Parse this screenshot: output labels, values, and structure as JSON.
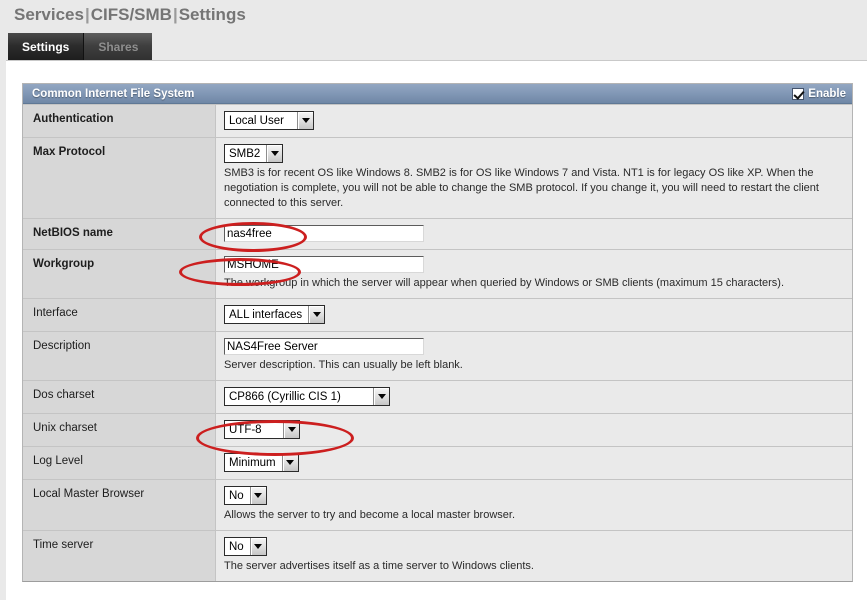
{
  "breadcrumb": {
    "parts": [
      "Services",
      "CIFS/SMB",
      "Settings"
    ],
    "separator": "|",
    "full": "Services | CIFS/SMB | Settings"
  },
  "tabs": [
    {
      "label": "Settings",
      "active": true
    },
    {
      "label": "Shares",
      "active": false
    }
  ],
  "panel": {
    "title": "Common Internet File System",
    "enable_label": "Enable",
    "enable_checked": true,
    "accent_color": "#7f95b4",
    "annotation_color": "#cc1f1f"
  },
  "rows": [
    {
      "label": "Authentication",
      "required": true,
      "control": "select",
      "value": "Local User",
      "hint": ""
    },
    {
      "label": "Max Protocol",
      "required": true,
      "control": "select",
      "value": "SMB2",
      "hint": "SMB3 is for recent OS like Windows 8. SMB2 is for OS like Windows 7 and Vista. NT1 is for legacy OS like XP. When the negotiation is complete, you will not be able to change the SMB protocol. If you change it, you will need to restart the client connected to this server."
    },
    {
      "label": "NetBIOS name",
      "required": true,
      "control": "text",
      "value": "nas4free",
      "hint": ""
    },
    {
      "label": "Workgroup",
      "required": true,
      "control": "text",
      "value": "MSHOME",
      "hint": "The workgroup in which the server will appear when queried by Windows or SMB clients (maximum 15 characters)."
    },
    {
      "label": "Interface",
      "required": false,
      "control": "select",
      "value": "ALL interfaces",
      "hint": ""
    },
    {
      "label": "Description",
      "required": false,
      "control": "text",
      "value": "NAS4Free Server",
      "hint": "Server description. This can usually be left blank."
    },
    {
      "label": "Dos charset",
      "required": false,
      "control": "select",
      "value": "CP866 (Cyrillic CIS 1)",
      "hint": ""
    },
    {
      "label": "Unix charset",
      "required": false,
      "control": "select",
      "value": "UTF-8",
      "hint": ""
    },
    {
      "label": "Log Level",
      "required": false,
      "control": "select",
      "value": "Minimum",
      "hint": ""
    },
    {
      "label": "Local Master Browser",
      "required": false,
      "control": "select",
      "value": "No",
      "hint": "Allows the server to try and become a local master browser."
    },
    {
      "label": "Time server",
      "required": false,
      "control": "select",
      "value": "No",
      "hint": "The server advertises itself as a time server to Windows clients."
    }
  ],
  "icons": {
    "dropdown": "chevron-down-icon",
    "checkbox": "checkbox-checked-icon"
  }
}
